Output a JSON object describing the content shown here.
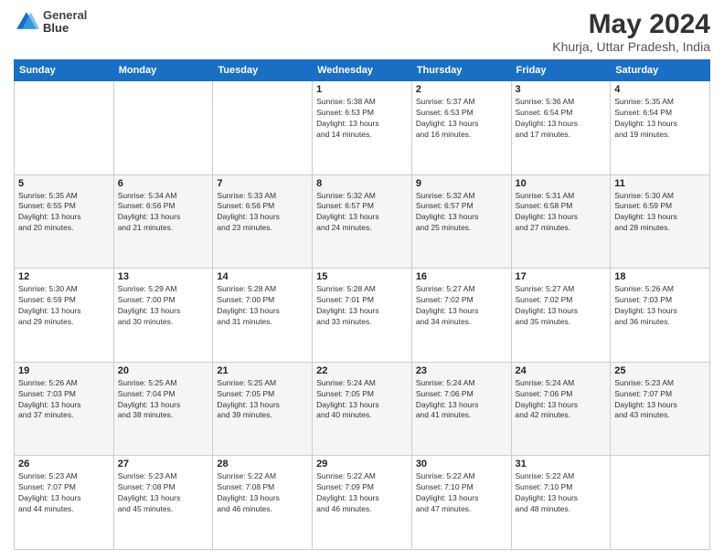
{
  "logo": {
    "line1": "General",
    "line2": "Blue"
  },
  "title": "May 2024",
  "subtitle": "Khurja, Uttar Pradesh, India",
  "days_of_week": [
    "Sunday",
    "Monday",
    "Tuesday",
    "Wednesday",
    "Thursday",
    "Friday",
    "Saturday"
  ],
  "weeks": [
    [
      {
        "day": "",
        "info": ""
      },
      {
        "day": "",
        "info": ""
      },
      {
        "day": "",
        "info": ""
      },
      {
        "day": "1",
        "info": "Sunrise: 5:38 AM\nSunset: 6:53 PM\nDaylight: 13 hours\nand 14 minutes."
      },
      {
        "day": "2",
        "info": "Sunrise: 5:37 AM\nSunset: 6:53 PM\nDaylight: 13 hours\nand 16 minutes."
      },
      {
        "day": "3",
        "info": "Sunrise: 5:36 AM\nSunset: 6:54 PM\nDaylight: 13 hours\nand 17 minutes."
      },
      {
        "day": "4",
        "info": "Sunrise: 5:35 AM\nSunset: 6:54 PM\nDaylight: 13 hours\nand 19 minutes."
      }
    ],
    [
      {
        "day": "5",
        "info": "Sunrise: 5:35 AM\nSunset: 6:55 PM\nDaylight: 13 hours\nand 20 minutes."
      },
      {
        "day": "6",
        "info": "Sunrise: 5:34 AM\nSunset: 6:56 PM\nDaylight: 13 hours\nand 21 minutes."
      },
      {
        "day": "7",
        "info": "Sunrise: 5:33 AM\nSunset: 6:56 PM\nDaylight: 13 hours\nand 23 minutes."
      },
      {
        "day": "8",
        "info": "Sunrise: 5:32 AM\nSunset: 6:57 PM\nDaylight: 13 hours\nand 24 minutes."
      },
      {
        "day": "9",
        "info": "Sunrise: 5:32 AM\nSunset: 6:57 PM\nDaylight: 13 hours\nand 25 minutes."
      },
      {
        "day": "10",
        "info": "Sunrise: 5:31 AM\nSunset: 6:58 PM\nDaylight: 13 hours\nand 27 minutes."
      },
      {
        "day": "11",
        "info": "Sunrise: 5:30 AM\nSunset: 6:59 PM\nDaylight: 13 hours\nand 28 minutes."
      }
    ],
    [
      {
        "day": "12",
        "info": "Sunrise: 5:30 AM\nSunset: 6:59 PM\nDaylight: 13 hours\nand 29 minutes."
      },
      {
        "day": "13",
        "info": "Sunrise: 5:29 AM\nSunset: 7:00 PM\nDaylight: 13 hours\nand 30 minutes."
      },
      {
        "day": "14",
        "info": "Sunrise: 5:28 AM\nSunset: 7:00 PM\nDaylight: 13 hours\nand 31 minutes."
      },
      {
        "day": "15",
        "info": "Sunrise: 5:28 AM\nSunset: 7:01 PM\nDaylight: 13 hours\nand 33 minutes."
      },
      {
        "day": "16",
        "info": "Sunrise: 5:27 AM\nSunset: 7:02 PM\nDaylight: 13 hours\nand 34 minutes."
      },
      {
        "day": "17",
        "info": "Sunrise: 5:27 AM\nSunset: 7:02 PM\nDaylight: 13 hours\nand 35 minutes."
      },
      {
        "day": "18",
        "info": "Sunrise: 5:26 AM\nSunset: 7:03 PM\nDaylight: 13 hours\nand 36 minutes."
      }
    ],
    [
      {
        "day": "19",
        "info": "Sunrise: 5:26 AM\nSunset: 7:03 PM\nDaylight: 13 hours\nand 37 minutes."
      },
      {
        "day": "20",
        "info": "Sunrise: 5:25 AM\nSunset: 7:04 PM\nDaylight: 13 hours\nand 38 minutes."
      },
      {
        "day": "21",
        "info": "Sunrise: 5:25 AM\nSunset: 7:05 PM\nDaylight: 13 hours\nand 39 minutes."
      },
      {
        "day": "22",
        "info": "Sunrise: 5:24 AM\nSunset: 7:05 PM\nDaylight: 13 hours\nand 40 minutes."
      },
      {
        "day": "23",
        "info": "Sunrise: 5:24 AM\nSunset: 7:06 PM\nDaylight: 13 hours\nand 41 minutes."
      },
      {
        "day": "24",
        "info": "Sunrise: 5:24 AM\nSunset: 7:06 PM\nDaylight: 13 hours\nand 42 minutes."
      },
      {
        "day": "25",
        "info": "Sunrise: 5:23 AM\nSunset: 7:07 PM\nDaylight: 13 hours\nand 43 minutes."
      }
    ],
    [
      {
        "day": "26",
        "info": "Sunrise: 5:23 AM\nSunset: 7:07 PM\nDaylight: 13 hours\nand 44 minutes."
      },
      {
        "day": "27",
        "info": "Sunrise: 5:23 AM\nSunset: 7:08 PM\nDaylight: 13 hours\nand 45 minutes."
      },
      {
        "day": "28",
        "info": "Sunrise: 5:22 AM\nSunset: 7:08 PM\nDaylight: 13 hours\nand 46 minutes."
      },
      {
        "day": "29",
        "info": "Sunrise: 5:22 AM\nSunset: 7:09 PM\nDaylight: 13 hours\nand 46 minutes."
      },
      {
        "day": "30",
        "info": "Sunrise: 5:22 AM\nSunset: 7:10 PM\nDaylight: 13 hours\nand 47 minutes."
      },
      {
        "day": "31",
        "info": "Sunrise: 5:22 AM\nSunset: 7:10 PM\nDaylight: 13 hours\nand 48 minutes."
      },
      {
        "day": "",
        "info": ""
      }
    ]
  ]
}
